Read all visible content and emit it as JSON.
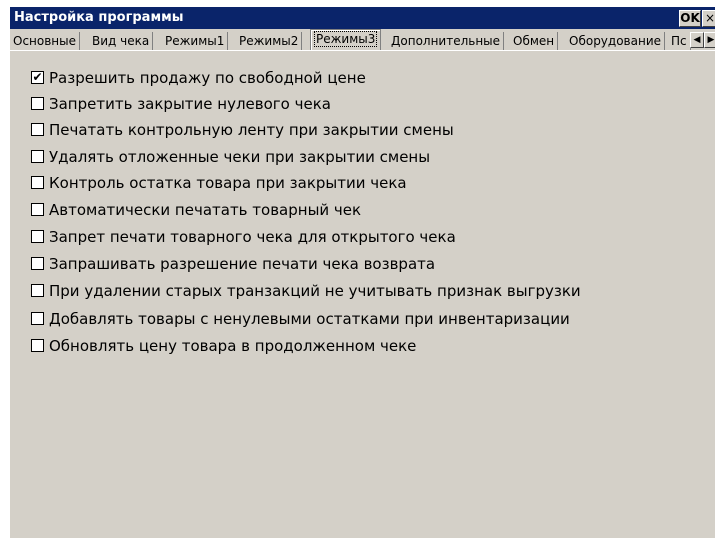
{
  "window": {
    "title": "Настройка программы",
    "ok_label": "OK",
    "close_label": "×"
  },
  "tabs": [
    {
      "label": "Основные"
    },
    {
      "label": "Вид чека"
    },
    {
      "label": "Режимы1"
    },
    {
      "label": "Режимы2"
    },
    {
      "label": "Режимы3",
      "active": true
    },
    {
      "label": "Дополнительные"
    },
    {
      "label": "Обмен"
    },
    {
      "label": "Оборудование"
    },
    {
      "label": "Пс"
    }
  ],
  "tab_scroll": {
    "left_icon": "◀",
    "right_icon": "▶"
  },
  "options": [
    {
      "label": "Разрешить продажу по свободной цене",
      "checked": true,
      "mark": "✔"
    },
    {
      "label": "Запретить закрытие нулевого чека",
      "checked": false,
      "mark": ""
    },
    {
      "label": "Печатать контрольную ленту при закрытии смены",
      "checked": false,
      "mark": ""
    },
    {
      "label": "Удалять отложенные чеки при закрытии смены",
      "checked": false,
      "mark": ""
    },
    {
      "label": "Контроль остатка товара при закрытии чека",
      "checked": false,
      "mark": ""
    },
    {
      "label": "Автоматически печатать товарный чек",
      "checked": false,
      "mark": ""
    },
    {
      "label": "Запрет печати товарного чека для открытого чека",
      "checked": false,
      "mark": ""
    },
    {
      "label": "Запрашивать разрешение печати чека возврата",
      "checked": false,
      "mark": ""
    },
    {
      "label": "При удалении старых транзакций не учитывать признак выгрузки",
      "checked": false,
      "mark": ""
    },
    {
      "label": "Добавлять товары с ненулевыми остатками при инвентаризации",
      "checked": false,
      "mark": ""
    },
    {
      "label": "Обновлять цену товара  в продолженном чеке",
      "checked": false,
      "mark": ""
    }
  ]
}
